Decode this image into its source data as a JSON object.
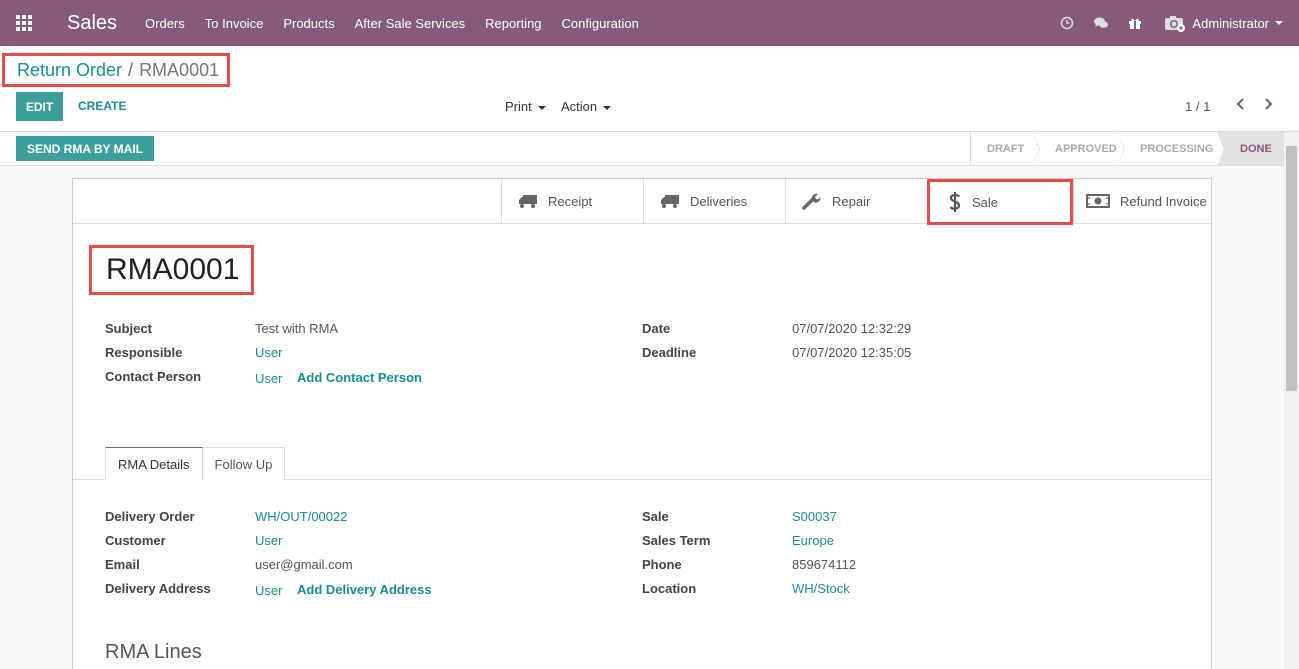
{
  "navbar": {
    "brand": "Sales",
    "menu": [
      "Orders",
      "To Invoice",
      "Products",
      "After Sale Services",
      "Reporting",
      "Configuration"
    ],
    "user": "Administrator"
  },
  "breadcrumb": {
    "parent": "Return Order",
    "separator": "/",
    "current": "RMA0001"
  },
  "controls": {
    "edit_label": "EDIT",
    "create_label": "CREATE",
    "print_label": "Print",
    "action_label": "Action",
    "pager": "1 / 1"
  },
  "statusbar": {
    "send_label": "SEND RMA BY MAIL",
    "stages": [
      "DRAFT",
      "APPROVED",
      "PROCESSING",
      "DONE"
    ],
    "active_stage": "DONE"
  },
  "smart_buttons": {
    "receipt": "Receipt",
    "deliveries": "Deliveries",
    "repair": "Repair",
    "sale": "Sale",
    "refund": "Refund Invoice"
  },
  "record": {
    "name": "RMA0001",
    "subject_label": "Subject",
    "subject": "Test with RMA",
    "responsible_label": "Responsible",
    "responsible": "User",
    "contact_label": "Contact Person",
    "contact": "User",
    "add_contact": "Add Contact Person",
    "date_label": "Date",
    "date": "07/07/2020 12:32:29",
    "deadline_label": "Deadline",
    "deadline": "07/07/2020 12:35:05"
  },
  "tabs": {
    "details": "RMA Details",
    "followup": "Follow Up"
  },
  "details": {
    "delivery_order_label": "Delivery Order",
    "delivery_order": "WH/OUT/00022",
    "customer_label": "Customer",
    "customer": "User",
    "email_label": "Email",
    "email": "user@gmail.com",
    "delivery_address_label": "Delivery Address",
    "delivery_address": "User",
    "add_delivery_address": "Add Delivery Address",
    "sale_label": "Sale",
    "sale": "S00037",
    "sales_term_label": "Sales Term",
    "sales_term": "Europe",
    "phone_label": "Phone",
    "phone": "859674112",
    "location_label": "Location",
    "location": "WH/Stock"
  },
  "lines_title": "RMA Lines",
  "colors": {
    "navbar": "#875a7b",
    "primary": "#3b9f9b",
    "link": "#1a8f8c",
    "highlight": "#e74c4c"
  }
}
